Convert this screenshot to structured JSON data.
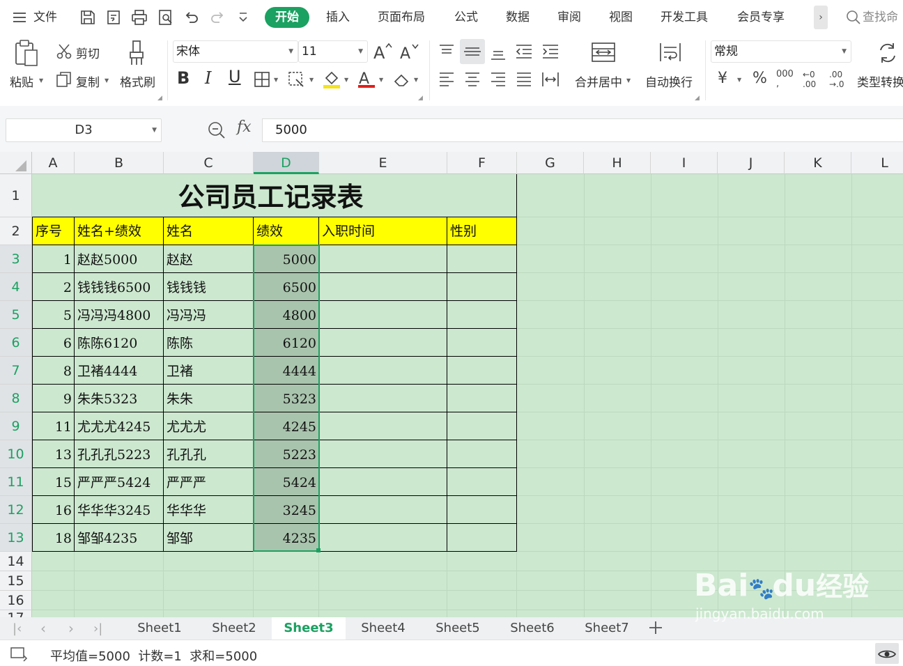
{
  "menu": {
    "file_label": "文件",
    "tabs": [
      "开始",
      "插入",
      "页面布局",
      "公式",
      "数据",
      "审阅",
      "视图",
      "开发工具",
      "会员专享"
    ],
    "search_label": "查找命"
  },
  "ribbon": {
    "paste": "粘贴",
    "cut": "剪切",
    "copy": "复制",
    "format_painter": "格式刷",
    "font_name": "宋体",
    "font_size": "11",
    "merge_center": "合并居中",
    "wrap_text": "自动换行",
    "number_format": "常规",
    "convert_type": "类型转换",
    "percent": "%",
    "thousands": "000",
    "dec_increase": ".00",
    "dec_decrease": ".00"
  },
  "formula_bar": {
    "name_box": "D3",
    "fx": "fx",
    "value": "5000"
  },
  "grid": {
    "columns": [
      "A",
      "B",
      "C",
      "D",
      "E",
      "F",
      "G",
      "H",
      "I",
      "J",
      "K",
      "L"
    ],
    "selected_column": "D",
    "row_numbers": [
      "1",
      "2",
      "3",
      "4",
      "5",
      "6",
      "7",
      "8",
      "9",
      "10",
      "11",
      "12",
      "13",
      "14",
      "15",
      "16",
      "17"
    ],
    "title": "公司员工记录表",
    "headers": [
      "序号",
      "姓名+绩效",
      "姓名",
      "绩效",
      "入职时间",
      "性别"
    ],
    "rows": [
      {
        "no": "1",
        "name_perf": "赵赵5000",
        "name": "赵赵",
        "perf": "5000"
      },
      {
        "no": "2",
        "name_perf": "钱钱钱6500",
        "name": "钱钱钱",
        "perf": "6500"
      },
      {
        "no": "5",
        "name_perf": "冯冯冯4800",
        "name": "冯冯冯",
        "perf": "4800"
      },
      {
        "no": "6",
        "name_perf": "陈陈6120",
        "name": "陈陈",
        "perf": "6120"
      },
      {
        "no": "8",
        "name_perf": "卫褚4444",
        "name": "卫褚",
        "perf": "4444"
      },
      {
        "no": "9",
        "name_perf": "朱朱5323",
        "name": "朱朱",
        "perf": "5323"
      },
      {
        "no": "11",
        "name_perf": "尤尤尤4245",
        "name": "尤尤尤",
        "perf": "4245"
      },
      {
        "no": "13",
        "name_perf": "孔孔孔5223",
        "name": "孔孔孔",
        "perf": "5223"
      },
      {
        "no": "15",
        "name_perf": "严严严5424",
        "name": "严严严",
        "perf": "5424"
      },
      {
        "no": "16",
        "name_perf": "华华华3245",
        "name": "华华华",
        "perf": "3245"
      },
      {
        "no": "18",
        "name_perf": "邹邹4235",
        "name": "邹邹",
        "perf": "4235"
      }
    ]
  },
  "sheets": {
    "names": [
      "Sheet1",
      "Sheet2",
      "Sheet3",
      "Sheet4",
      "Sheet5",
      "Sheet6",
      "Sheet7"
    ],
    "active": "Sheet3"
  },
  "status": {
    "summary": "平均值=5000  计数=1  求和=5000"
  },
  "watermark": {
    "brand": "Bai",
    "brand2": "du",
    "suffix": "经验",
    "url": "jingyan.baidu.com"
  },
  "colors": {
    "accent": "#1ba161",
    "sheet_bg": "#cce8cf",
    "header_fill": "#ffff00",
    "selection_fill": "#a9c4ad"
  }
}
